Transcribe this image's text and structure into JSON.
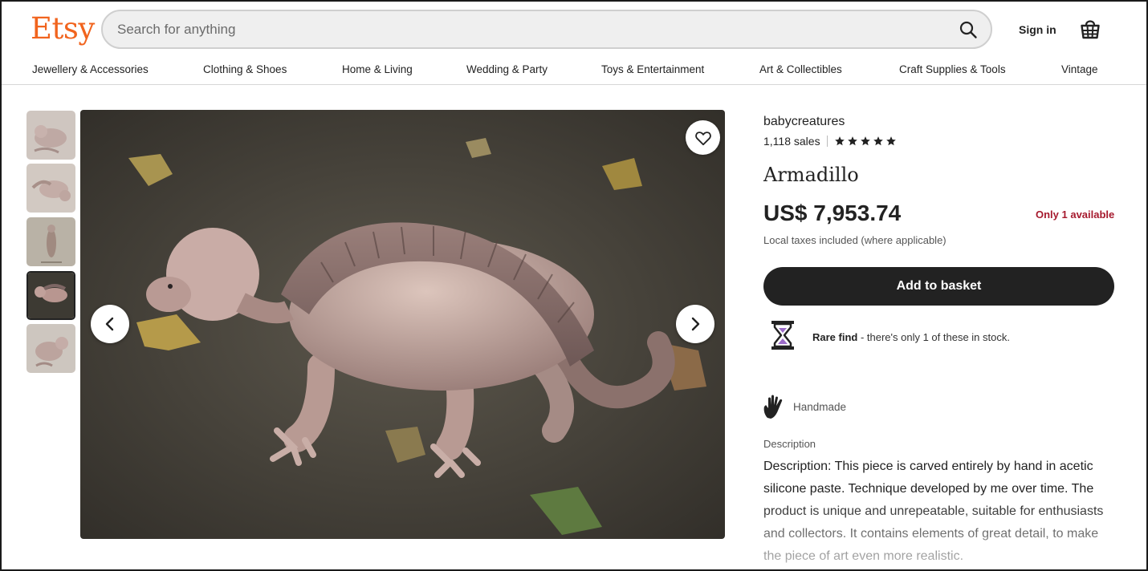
{
  "header": {
    "logo": "Etsy",
    "search_placeholder": "Search for anything",
    "signin_label": "Sign in",
    "icons": {
      "search": "search-icon",
      "basket": "basket-icon"
    }
  },
  "nav": {
    "items": [
      "Jewellery & Accessories",
      "Clothing & Shoes",
      "Home & Living",
      "Wedding & Party",
      "Toys & Entertainment",
      "Art & Collectibles",
      "Craft Supplies & Tools",
      "Vintage"
    ]
  },
  "gallery": {
    "thumbnail_count": 5,
    "active_index": 3
  },
  "listing": {
    "shop_name": "babycreatures",
    "sales": "1,118 sales",
    "rating_stars": 5,
    "title": "Armadillo",
    "price": "US$ 7,953.74",
    "availability": "Only 1 available",
    "tax_note": "Local taxes included (where applicable)",
    "add_to_basket": "Add to basket",
    "rare_find_bold": "Rare find",
    "rare_find_text": " - there's only 1 of these in stock.",
    "handmade": "Handmade",
    "description_label": "Description",
    "description": "Description: This piece is carved entirely by hand in acetic silicone paste. Technique developed by me over time. The product is unique and unrepeatable, suitable for enthusiasts and collectors. It contains elements of great detail, to make the piece of art even more realistic."
  },
  "colors": {
    "brand": "#F1641E",
    "button_dark": "#222222",
    "availability_red": "#A61A2E",
    "hourglass_purple": "#9B6BC8"
  }
}
